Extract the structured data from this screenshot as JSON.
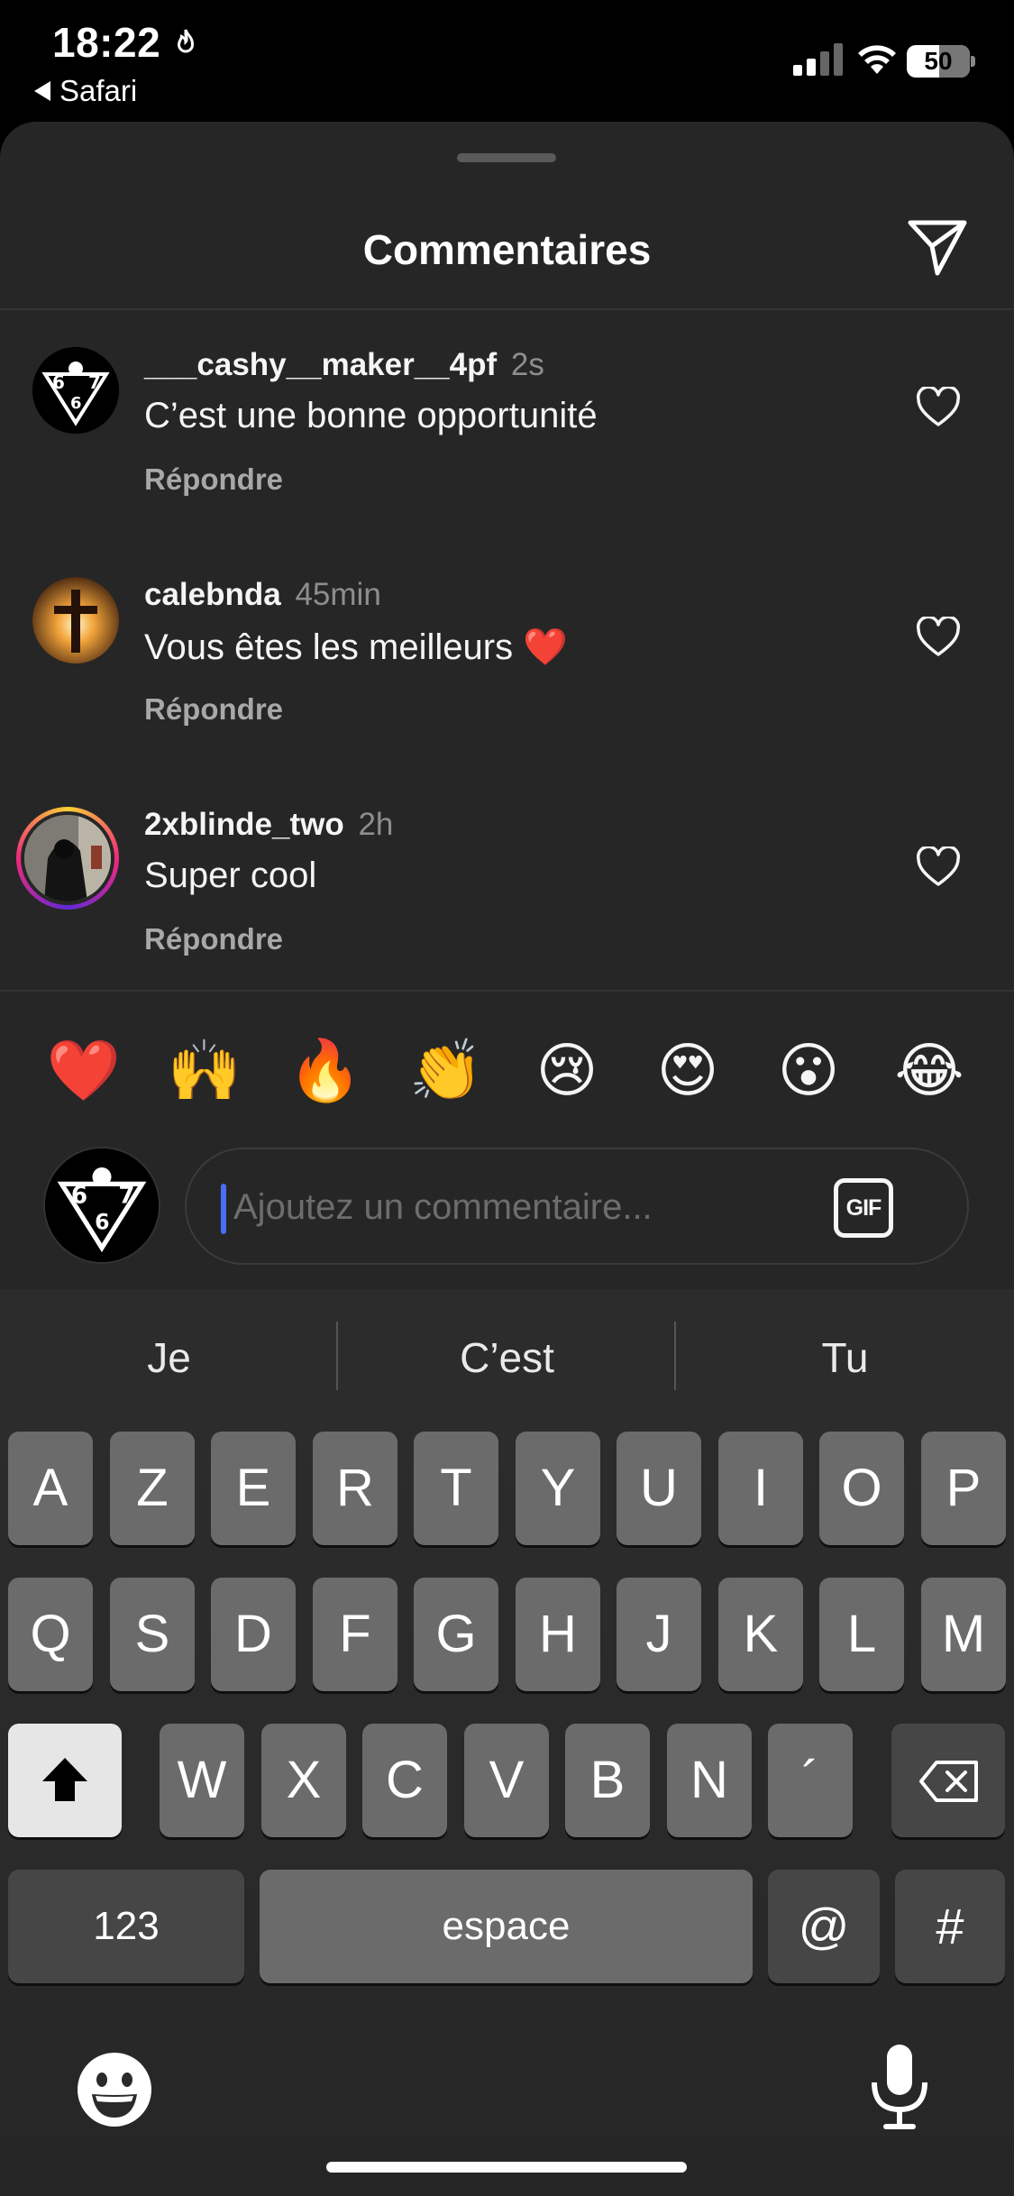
{
  "status_bar": {
    "time": "18:22",
    "back_app": "Safari",
    "battery": "50"
  },
  "sheet": {
    "title": "Commentaires",
    "send_icon": "paper-plane-icon"
  },
  "comments": [
    {
      "user": "___cashy__maker__4pf",
      "time": "2s",
      "text": "C’est une bonne opportunité",
      "reply": "Répondre"
    },
    {
      "user": "calebnda",
      "time": "45min",
      "text": "Vous êtes les meilleurs ❤️",
      "reply": "Répondre"
    },
    {
      "user": "2xblinde_two",
      "time": "2h",
      "text": "Super cool",
      "reply": "Répondre"
    }
  ],
  "quick_reactions": [
    "❤️",
    "🙌",
    "🔥",
    "👏",
    "😢",
    "😍",
    "😮",
    "😂"
  ],
  "composer": {
    "placeholder": "Ajoutez un commentaire...",
    "gif_label": "GIF"
  },
  "keyboard": {
    "predictions": [
      "Je",
      "C’est",
      "Tu"
    ],
    "row1": [
      "A",
      "Z",
      "E",
      "R",
      "T",
      "Y",
      "U",
      "I",
      "O",
      "P"
    ],
    "row2": [
      "Q",
      "S",
      "D",
      "F",
      "G",
      "H",
      "J",
      "K",
      "L",
      "M"
    ],
    "row3": [
      "W",
      "X",
      "C",
      "V",
      "B",
      "N",
      "´"
    ],
    "numbers_key": "123",
    "space_key": "espace",
    "at_key": "@",
    "hash_key": "#"
  },
  "colors": {
    "sheet_bg": "#262626",
    "key_bg": "#6b6b6b",
    "cursor": "#4a6cf7"
  }
}
